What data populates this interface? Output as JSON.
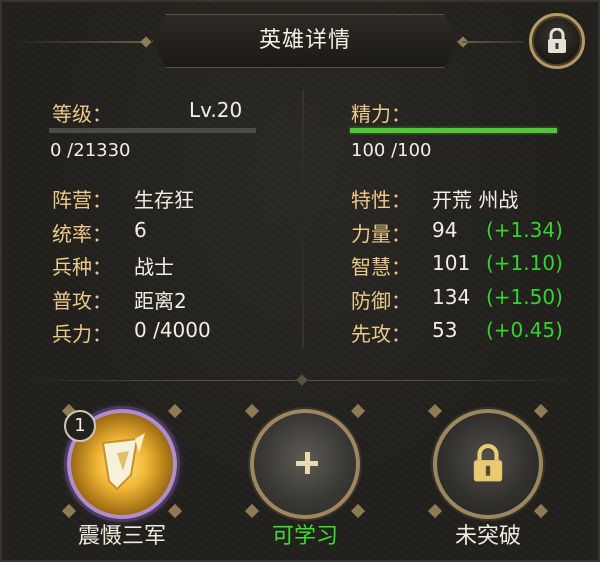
{
  "header": {
    "title": "英雄详情",
    "lock_icon": "lock-icon"
  },
  "left": {
    "level_label": "等级：",
    "level_value": "Lv.20",
    "exp_text": "0 /21330",
    "rows": [
      {
        "label": "阵营：",
        "value": "生存狂"
      },
      {
        "label": "统率：",
        "value": "6"
      },
      {
        "label": "兵种：",
        "value": "战士"
      },
      {
        "label": "普攻：",
        "value": "距离2"
      },
      {
        "label": "兵力：",
        "value": "0 /4000"
      }
    ]
  },
  "right": {
    "energy_label": "精力：",
    "energy_text": "100 /100",
    "energy_fraction": 1.0,
    "trait_label": "特性：",
    "trait_value": "开荒 州战",
    "stats": [
      {
        "label": "力量：",
        "value": "94",
        "growth": "(+1.34)"
      },
      {
        "label": "智慧：",
        "value": "101",
        "growth": "(+1.10)"
      },
      {
        "label": "防御：",
        "value": "134",
        "growth": "(+1.50)"
      },
      {
        "label": "先攻：",
        "value": "53",
        "growth": "(+0.45)"
      }
    ]
  },
  "skills": [
    {
      "name": "震慑三军",
      "badge": "1",
      "icon": "shield-skill-icon",
      "label_color": "#f1ece0"
    },
    {
      "name": "可学习",
      "icon": "plus-icon",
      "label_color": "#3ddc2e"
    },
    {
      "name": "未突破",
      "icon": "lock-icon",
      "label_color": "#f1ece0"
    }
  ],
  "colors": {
    "label": "#ecc98a",
    "growth": "#34d42c",
    "energy_bar": "#4fc736"
  }
}
